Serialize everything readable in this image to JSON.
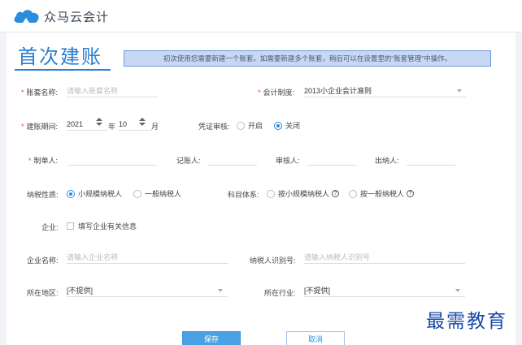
{
  "app": {
    "logo_text": "众马云会计",
    "logo_icon": "cloud-icon",
    "brand_color": "#2b8de0"
  },
  "page": {
    "title": "首次建账",
    "notice": "初次使用您需要新建一个账套。如需要新建多个账套，稍后可以在设置里的“账套管理”中操作。"
  },
  "form": {
    "account_name": {
      "label": "账套名称:",
      "placeholder": "请输入账套名称",
      "required": true
    },
    "accounting_system": {
      "label": "会计制度:",
      "value": "2013小企业会计准则",
      "required": true
    },
    "period": {
      "label": "建账期间:",
      "year": "2021",
      "year_unit": "年",
      "month": "10",
      "month_unit": "月",
      "required": true
    },
    "voucher_review": {
      "label": "凭证审核:",
      "options": [
        "开启",
        "关闭"
      ],
      "selected": "关闭"
    },
    "preparer": {
      "label": "制单人:",
      "required": true
    },
    "bookkeeper": {
      "label": "记账人:"
    },
    "auditor": {
      "label": "审核人:"
    },
    "cashier": {
      "label": "出纳人:"
    },
    "tax_nature": {
      "label": "纳税性质:",
      "options": [
        "小规模纳税人",
        "一般纳税人"
      ],
      "selected": "小规模纳税人"
    },
    "subject_system": {
      "label": "科目体系:",
      "options": [
        "按小规模纳税人",
        "按一般纳税人"
      ],
      "selected": ""
    },
    "enterprise": {
      "label": "企业:",
      "checkbox_label": "填写企业有关信息",
      "checked": false
    },
    "company_name": {
      "label": "企业名称:",
      "placeholder": "请输入企业名称"
    },
    "taxpayer_id": {
      "label": "纳税人识别号:",
      "placeholder": "请输入纳税人识别号"
    },
    "region": {
      "label": "所在地区:",
      "value": "[不提供]"
    },
    "industry": {
      "label": "所在行业:",
      "value": "[不提供]"
    }
  },
  "buttons": {
    "save": "保存",
    "cancel": "取消"
  },
  "watermark": "最需教育"
}
